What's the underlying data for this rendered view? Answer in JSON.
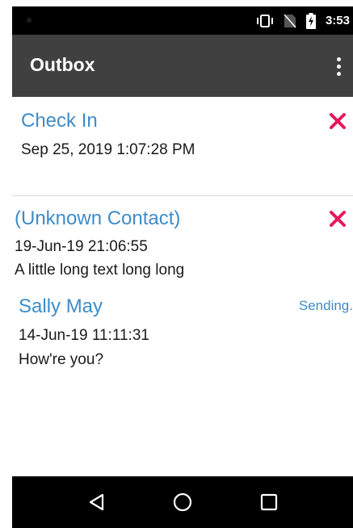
{
  "status_bar": {
    "time": "3:53",
    "icons": [
      "vibrate-icon",
      "no-sim-icon",
      "battery-charging-icon"
    ]
  },
  "toolbar": {
    "title": "Outbox",
    "overflow_icon": "overflow-menu-icon"
  },
  "messages": [
    {
      "name": "Check In",
      "date": "Sep 25, 2019 1:07:28 PM",
      "body": "",
      "action": "delete",
      "status": ""
    },
    {
      "name": "(Unknown Contact)",
      "date": "19-Jun-19 21:06:55",
      "body": "A little long text long long",
      "action": "delete",
      "status": ""
    },
    {
      "name": "Sally May",
      "date": "14-Jun-19 11:11:31",
      "body": "How're you?",
      "action": "",
      "status": "Sending."
    }
  ],
  "navigation": {
    "buttons": [
      "back-icon",
      "home-icon",
      "recents-icon"
    ]
  },
  "colors": {
    "accent": "#3d8cc9",
    "delete": "#e8175d",
    "toolbar": "#404040",
    "status_bar": "#000000"
  }
}
